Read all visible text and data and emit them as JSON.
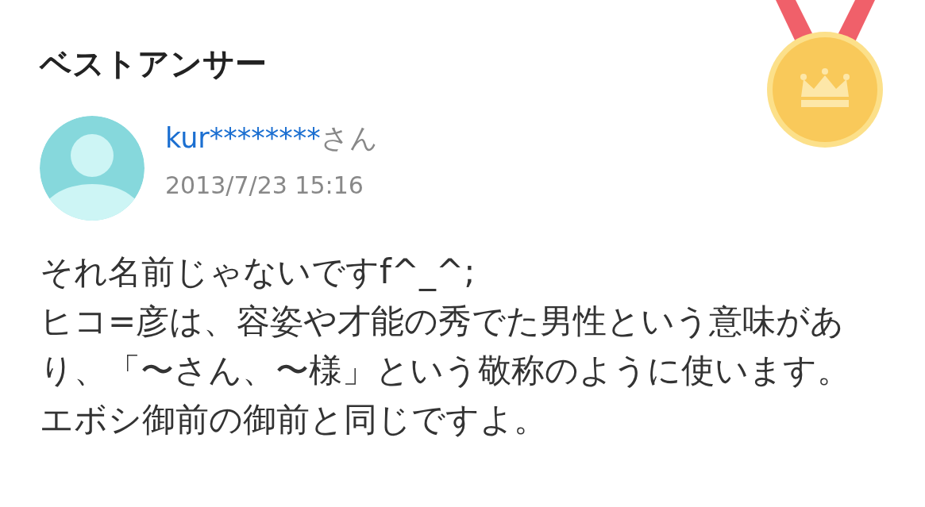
{
  "title": "ベストアンサー",
  "answer": {
    "user": "kur********",
    "honorific": "さん",
    "date": "2013/7/23 15:16",
    "paragraphs": [
      "それ名前じゃないですf^_^;",
      "ヒコ=彦は、容姿や才能の秀でた男性という意味があり、「〜さん、〜様」という敬称のように使います。",
      "エボシ御前の御前と同じですよ。"
    ]
  }
}
